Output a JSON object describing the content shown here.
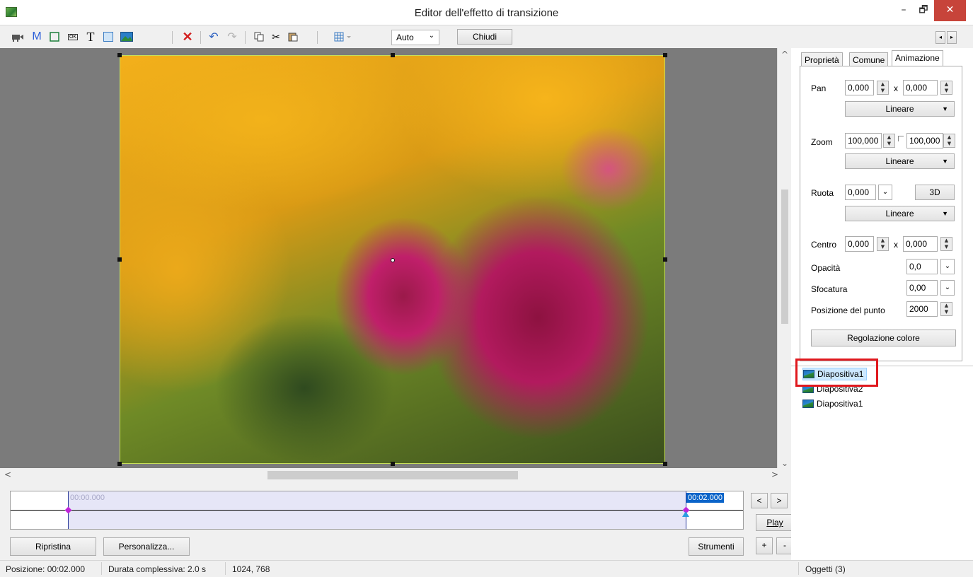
{
  "window": {
    "title": "Editor dell'effetto di transizione",
    "minimize": "–",
    "maximize": "🗗",
    "close": "✕"
  },
  "toolbar": {
    "icons": [
      "camera-icon",
      "m-icon",
      "frame-icon",
      "ok-icon",
      "text-icon",
      "rectangle-icon",
      "image-icon",
      "delete-icon",
      "undo-icon",
      "redo-icon",
      "copy-icon",
      "cut-icon",
      "paste-icon",
      "grid-icon"
    ],
    "m_label": "M",
    "t_label": "T",
    "ok_label": "OK",
    "zoom_select": "Auto",
    "close_button": "Chiudi",
    "scroll_left": "◂",
    "scroll_right": "▸"
  },
  "timeline": {
    "start_time": "00:00.000",
    "end_time": "00:02.000",
    "prev_button": "<",
    "next_button": ">",
    "play_button": "Play",
    "plus_button": "+",
    "minus_button": "-"
  },
  "bottom_buttons": {
    "reset": "Ripristina",
    "customize": "Personalizza...",
    "tools": "Strumenti"
  },
  "tabs": [
    "Proprietà",
    "Comune",
    "Animazione"
  ],
  "properties": {
    "pan_label": "Pan",
    "pan_x": "0,000",
    "pan_y": "0,000",
    "pan_x_sep": "x",
    "pan_mode": "Lineare",
    "zoom_label": "Zoom",
    "zoom_x": "100,000",
    "zoom_y": "100,000",
    "zoom_mode": "Lineare",
    "rotate_label": "Ruota",
    "rotate_value": "0,000",
    "rotate_3d": "3D",
    "rotate_mode": "Lineare",
    "center_label": "Centro",
    "center_x": "0,000",
    "center_y": "0,000",
    "center_x_sep": "x",
    "opacity_label": "Opacità",
    "opacity_value": "0,0",
    "blur_label": "Sfocatura",
    "blur_value": "0,00",
    "point_pos_label": "Posizione del punto",
    "point_pos_value": "2000",
    "color_button": "Regolazione colore"
  },
  "objects": [
    {
      "label": "Diapositiva1",
      "selected": true
    },
    {
      "label": "Diapositiva2",
      "selected": false
    },
    {
      "label": "Diapositiva1",
      "selected": false
    }
  ],
  "status": {
    "position": "Posizione: 00:02.000",
    "duration": "Durata complessiva: 2.0 s",
    "size": "1024, 768",
    "objects": "Oggetti (3)"
  },
  "colors": {
    "accent": "#0a64c9",
    "highlight_red": "#e0191e",
    "keyframe": "#c024d9",
    "canvas_bg": "#7b7b7b"
  }
}
